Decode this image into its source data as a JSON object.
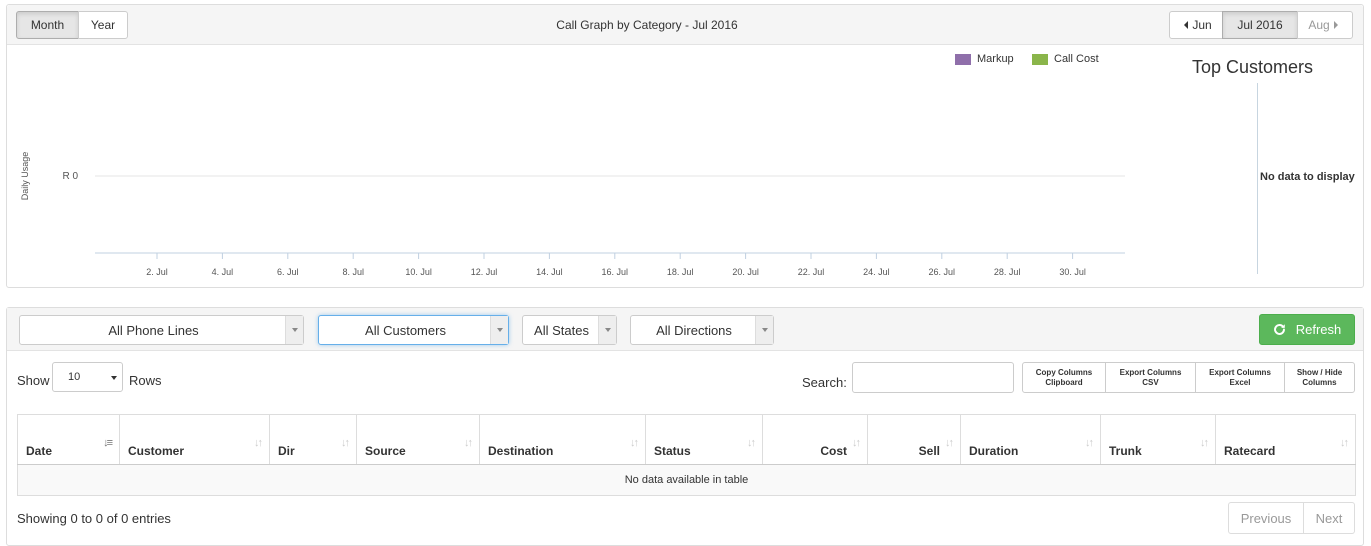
{
  "graph": {
    "period_buttons": {
      "month": "Month",
      "year": "Year"
    },
    "title": "Call Graph by Category - Jul 2016",
    "nav": {
      "prev": "Jun",
      "current": "Jul 2016",
      "next": "Aug"
    },
    "legend": [
      {
        "label": "Markup",
        "color": "#8f6faa"
      },
      {
        "label": "Call Cost",
        "color": "#8ab54a"
      }
    ],
    "top_customers": {
      "title": "Top Customers",
      "empty": "No data to display"
    }
  },
  "chart_data": {
    "type": "bar",
    "ylabel": "Daily Usage",
    "y_ticks": [
      "R 0"
    ],
    "x_ticks": [
      "2. Jul",
      "4. Jul",
      "6. Jul",
      "8. Jul",
      "10. Jul",
      "12. Jul",
      "14. Jul",
      "16. Jul",
      "18. Jul",
      "20. Jul",
      "22. Jul",
      "24. Jul",
      "26. Jul",
      "28. Jul",
      "30. Jul"
    ],
    "series": [
      {
        "name": "Markup",
        "values": []
      },
      {
        "name": "Call Cost",
        "values": []
      }
    ],
    "legend_position": "top-right"
  },
  "filters": {
    "phone_lines": "All Phone Lines",
    "customers": "All Customers",
    "states": "All States",
    "directions": "All Directions",
    "refresh": "Refresh"
  },
  "table_controls": {
    "show": "Show",
    "rows_value": "10",
    "rows": "Rows",
    "search": "Search:",
    "export_buttons": [
      {
        "line1": "Copy Columns",
        "line2": "Clipboard"
      },
      {
        "line1": "Export Columns",
        "line2": "CSV"
      },
      {
        "line1": "Export Columns",
        "line2": "Excel"
      },
      {
        "line1": "Show / Hide",
        "line2": "Columns"
      }
    ]
  },
  "table": {
    "columns": [
      "Date",
      "Customer",
      "Dir",
      "Source",
      "Destination",
      "Status",
      "Cost",
      "Sell",
      "Duration",
      "Trunk",
      "Ratecard"
    ],
    "empty": "No data available in table",
    "info": "Showing 0 to 0 of 0 entries",
    "pager": {
      "previous": "Previous",
      "next": "Next"
    }
  }
}
